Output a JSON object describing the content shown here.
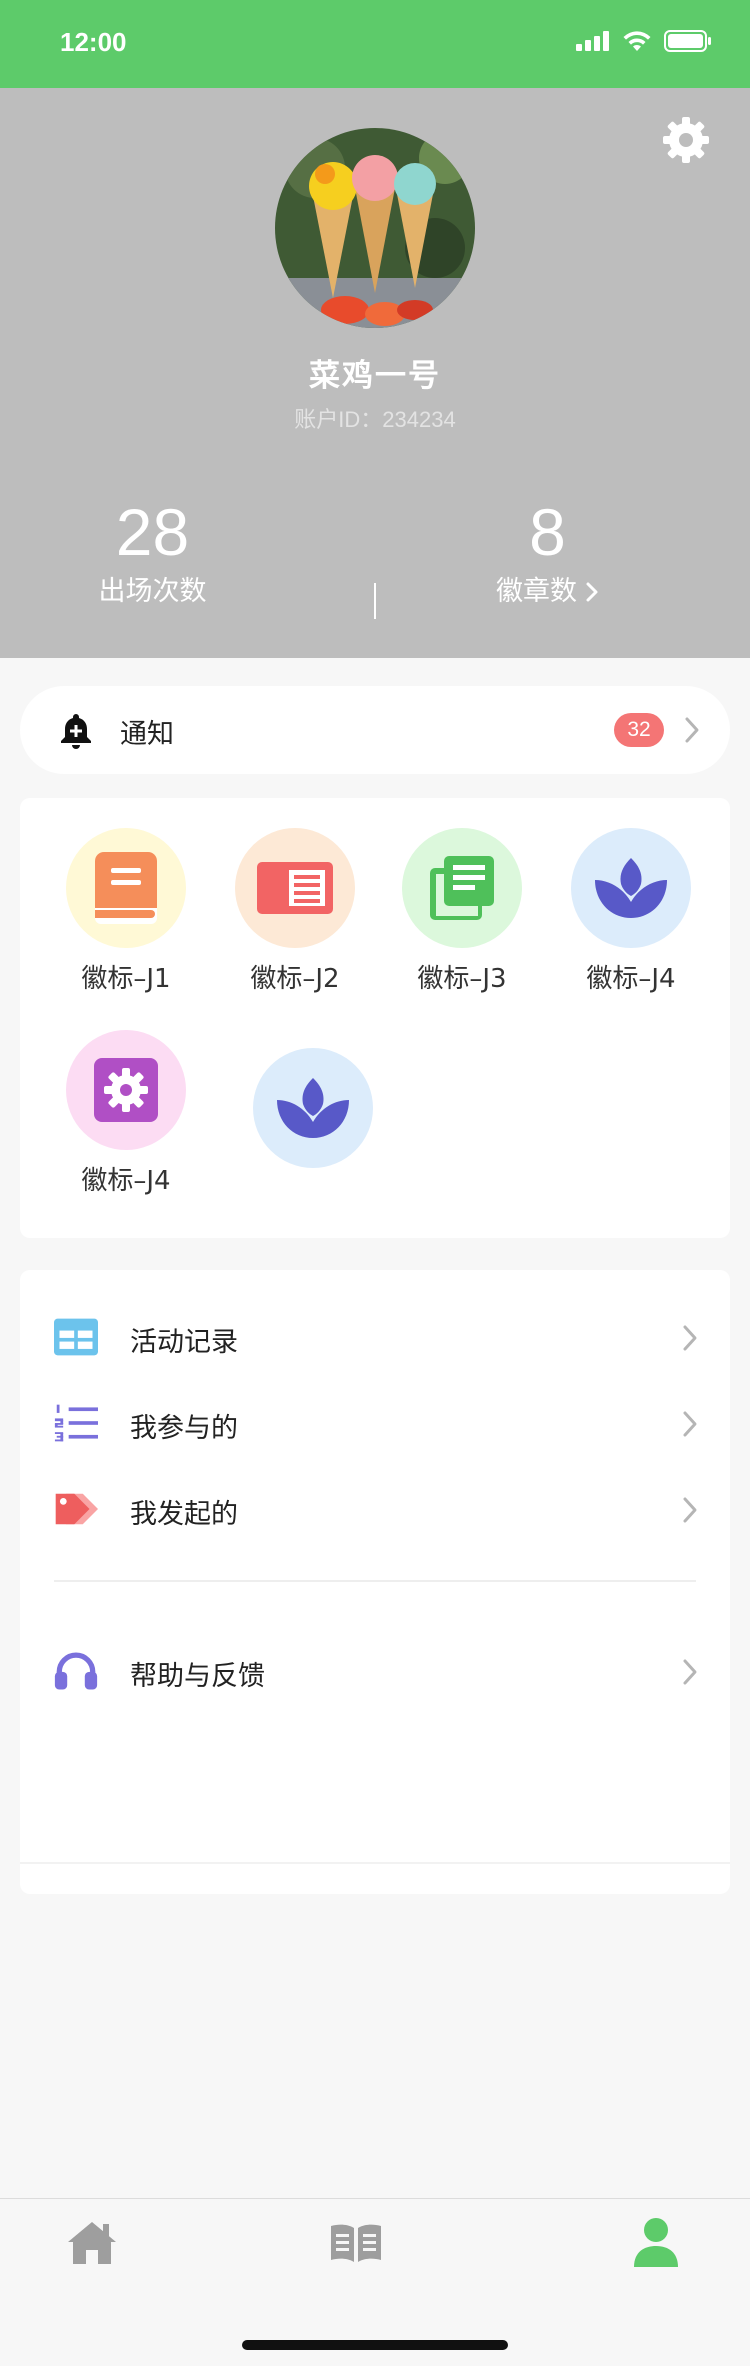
{
  "status_bar": {
    "time": "12:00"
  },
  "profile": {
    "nickname": "菜鸡一号",
    "account_id": "账户ID：234234",
    "stats": [
      {
        "value": "28",
        "label": "出场次数"
      },
      {
        "value": "8",
        "label": "徽章数"
      }
    ]
  },
  "notice": {
    "label": "通知",
    "count": "32"
  },
  "badges": [
    {
      "label": "徽标–J1",
      "icon": "book-icon",
      "bg": "#fff9d6",
      "color": "#f58e5a"
    },
    {
      "label": "徽标–J2",
      "icon": "newspaper-icon",
      "bg": "#fde9d6",
      "color": "#f26464"
    },
    {
      "label": "徽标–J3",
      "icon": "document-stack-icon",
      "bg": "#dcf8dc",
      "color": "#4fc05a"
    },
    {
      "label": "徽标–J4",
      "icon": "lotus-icon",
      "bg": "#dcecfb",
      "color": "#5859c8"
    },
    {
      "label": "徽标–J4",
      "icon": "gear-badge-icon",
      "bg": "#fcdcf3",
      "color": "#b04fc5"
    },
    {
      "label": "",
      "icon": "lotus-icon",
      "bg": "#dcecfb",
      "color": "#5859c8"
    }
  ],
  "menu": {
    "items": [
      {
        "label": "活动记录",
        "icon": "grid-icon"
      },
      {
        "label": "我参与的",
        "icon": "numbered-list-icon"
      },
      {
        "label": "我发起的",
        "icon": "tags-icon"
      },
      {
        "label": "帮助与反馈",
        "icon": "headphones-icon"
      }
    ]
  },
  "tabs": [
    {
      "name": "home",
      "icon": "home-icon"
    },
    {
      "name": "book",
      "icon": "open-book-icon"
    },
    {
      "name": "profile",
      "icon": "user-icon",
      "active": true
    }
  ],
  "colors": {
    "brand_green": "#5dcb6a",
    "header_gray": "#bdbdbd",
    "badge_red": "#f47575",
    "tab_inactive": "#9e9e9e"
  }
}
